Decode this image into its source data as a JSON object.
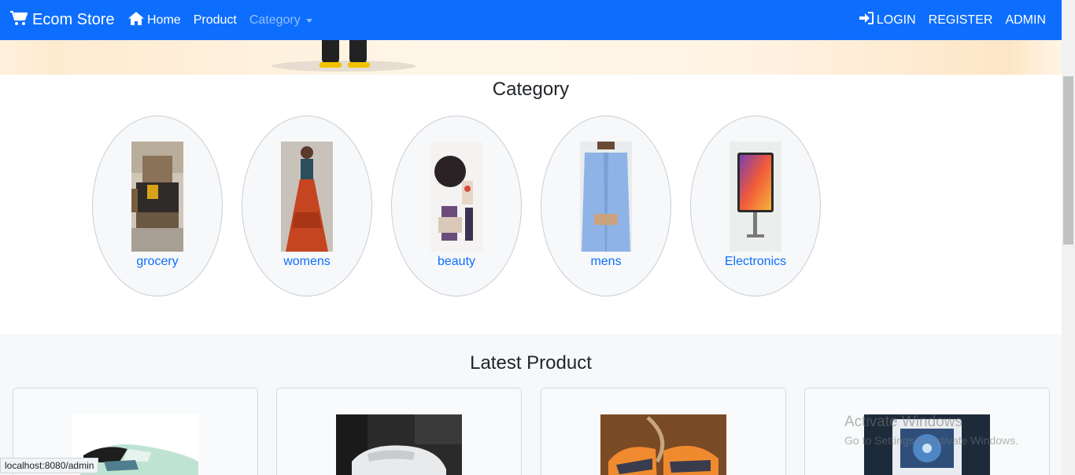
{
  "navbar": {
    "brand": "Ecom Store",
    "links": {
      "home": "Home",
      "product": "Product",
      "category": "Category"
    },
    "right": {
      "login": "LOGIN",
      "register": "REGISTER",
      "admin": "ADMIN"
    },
    "colors": {
      "background": "#0d6efd"
    }
  },
  "category_section": {
    "title": "Category",
    "items": [
      {
        "label": "grocery",
        "image": "bedroom-furniture"
      },
      {
        "label": "womens",
        "image": "orange-lehenga"
      },
      {
        "label": "beauty",
        "image": "cosmetics"
      },
      {
        "label": "mens",
        "image": "blue-shirt"
      },
      {
        "label": "Electronics",
        "image": "tablet"
      }
    ]
  },
  "latest_section": {
    "title": "Latest Product",
    "products": [
      {
        "image": "mint-sneaker"
      },
      {
        "image": "white-sneaker"
      },
      {
        "image": "orange-shoes"
      },
      {
        "image": "air-cooler"
      }
    ]
  },
  "status_bar": {
    "url": "localhost:8080/admin"
  },
  "watermark": {
    "title": "Activate Windows",
    "subtitle": "Go to Settings to activate Windows."
  },
  "icons": {
    "brand": "cart-icon",
    "home": "home-icon",
    "login": "sign-in-icon"
  }
}
